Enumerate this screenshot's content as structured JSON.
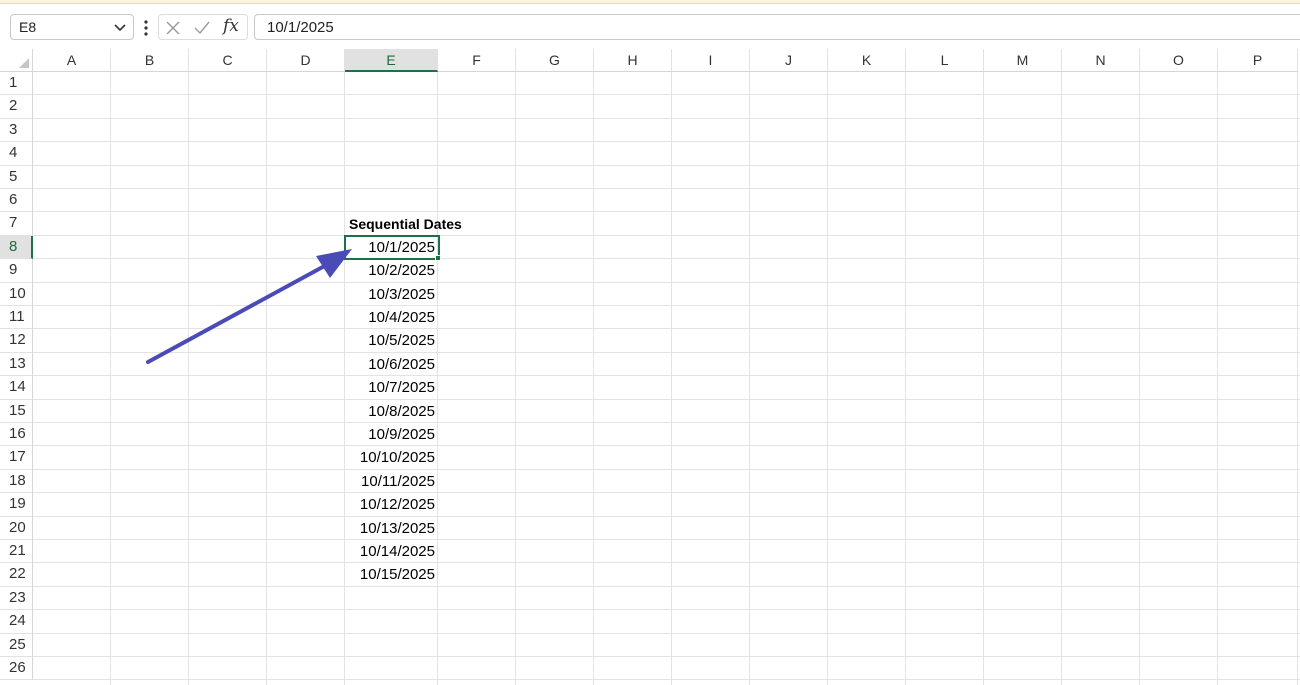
{
  "name_box": {
    "value": "E8"
  },
  "formula_bar": {
    "value": "10/1/2025",
    "fx_label": "fx"
  },
  "columns": [
    "A",
    "B",
    "C",
    "D",
    "E",
    "F",
    "G",
    "H",
    "I",
    "J",
    "K",
    "L",
    "M",
    "N",
    "O",
    "P"
  ],
  "rows": [
    "1",
    "2",
    "3",
    "4",
    "5",
    "6",
    "7",
    "8",
    "9",
    "10",
    "11",
    "12",
    "13",
    "14",
    "15",
    "16",
    "17",
    "18",
    "19",
    "20",
    "21",
    "22",
    "23",
    "24",
    "25",
    "26"
  ],
  "selected": {
    "column": "E",
    "row": "8"
  },
  "sheet": {
    "title_cell": {
      "ref": "E7",
      "value": "Sequential Dates"
    },
    "dates": [
      "10/1/2025",
      "10/2/2025",
      "10/3/2025",
      "10/4/2025",
      "10/5/2025",
      "10/6/2025",
      "10/7/2025",
      "10/8/2025",
      "10/9/2025",
      "10/10/2025",
      "10/11/2025",
      "10/12/2025",
      "10/13/2025",
      "10/14/2025",
      "10/15/2025"
    ]
  },
  "annotation": {
    "type": "arrow",
    "color": "#4b4bb8"
  },
  "colors": {
    "accent": "#1e7145",
    "header_selected": "#e1e1e1",
    "gridline": "#e3e3e3"
  }
}
